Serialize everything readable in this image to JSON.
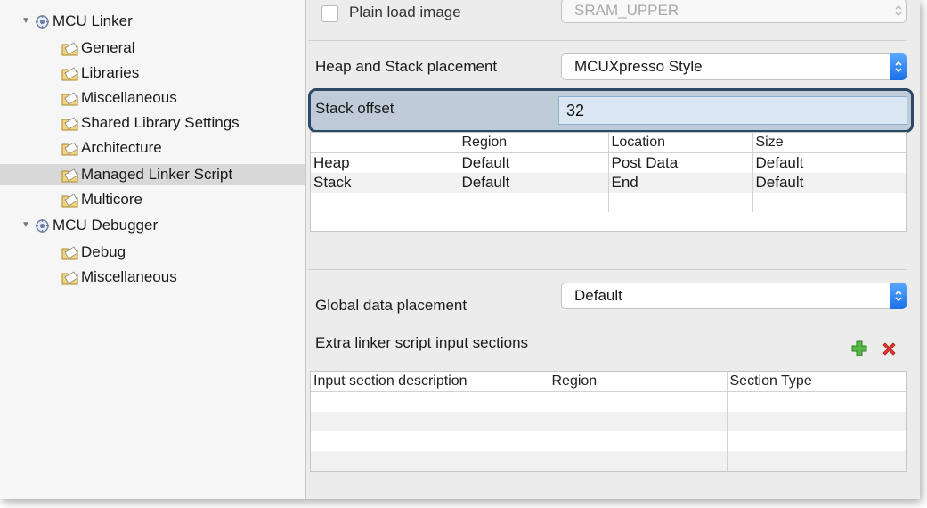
{
  "tree": {
    "groups": [
      {
        "label": "MCU Linker",
        "children": [
          "General",
          "Libraries",
          "Miscellaneous",
          "Shared Library Settings",
          "Architecture",
          "Managed Linker Script",
          "Multicore"
        ]
      },
      {
        "label": "MCU Debugger",
        "children": [
          "Debug",
          "Miscellaneous"
        ]
      }
    ],
    "selected": "Managed Linker Script"
  },
  "plain_load": {
    "label": "Plain load image",
    "checked": false,
    "region_value": "SRAM_UPPER"
  },
  "heap_stack": {
    "label": "Heap and Stack placement",
    "value": "MCUXpresso Style"
  },
  "stack_offset": {
    "label": "Stack offset",
    "value": "32"
  },
  "placement_table": {
    "headers": [
      "",
      "Region",
      "Location",
      "Size"
    ],
    "rows": [
      [
        "Heap",
        "Default",
        "Post Data",
        "Default"
      ],
      [
        "Stack",
        "Default",
        "End",
        "Default"
      ],
      [
        "",
        "",
        "",
        ""
      ]
    ]
  },
  "global_data": {
    "label": "Global data placement",
    "value": "Default"
  },
  "extra_sections": {
    "label": "Extra linker script input sections",
    "add_icon": "green-plus-icon",
    "remove_icon": "red-x-icon",
    "headers": [
      "Input section description",
      "Region",
      "Section Type"
    ],
    "empty_rows": 4
  },
  "colors": {
    "accent": "#1a6fe8",
    "highlight_border": "#2c4a66",
    "add": "#4caf3f",
    "remove": "#e53935"
  }
}
